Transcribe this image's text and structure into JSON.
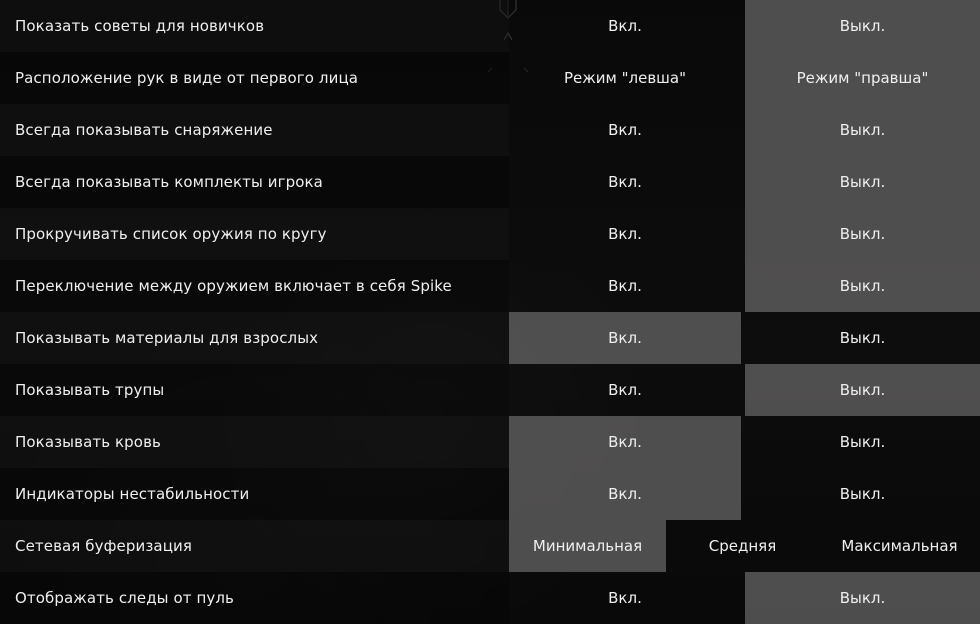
{
  "settings": [
    {
      "label": "Показать советы для новичков",
      "options": [
        "Вкл.",
        "Выкл."
      ],
      "selected": 1
    },
    {
      "label": "Расположение рук в виде от первого лица",
      "options": [
        "Режим \"левша\"",
        "Режим \"правша\""
      ],
      "selected": 1
    },
    {
      "label": "Всегда показывать снаряжение",
      "options": [
        "Вкл.",
        "Выкл."
      ],
      "selected": 1
    },
    {
      "label": "Всегда показывать комплекты игрока",
      "options": [
        "Вкл.",
        "Выкл."
      ],
      "selected": 1
    },
    {
      "label": "Прокручивать список оружия по кругу",
      "options": [
        "Вкл.",
        "Выкл."
      ],
      "selected": 1
    },
    {
      "label": "Переключение между оружием включает в себя Spike",
      "options": [
        "Вкл.",
        "Выкл."
      ],
      "selected": 1
    },
    {
      "label": "Показывать материалы для взрослых",
      "options": [
        "Вкл.",
        "Выкл."
      ],
      "selected": 0
    },
    {
      "label": "Показывать трупы",
      "options": [
        "Вкл.",
        "Выкл."
      ],
      "selected": 1
    },
    {
      "label": "Показывать кровь",
      "options": [
        "Вкл.",
        "Выкл."
      ],
      "selected": 0
    },
    {
      "label": "Индикаторы нестабильности",
      "options": [
        "Вкл.",
        "Выкл."
      ],
      "selected": 0
    },
    {
      "label": "Сетевая буферизация",
      "options": [
        "Минимальная",
        "Средняя",
        "Максимальная"
      ],
      "selected": 0
    },
    {
      "label": "Отображать следы от пуль",
      "options": [
        "Вкл.",
        "Выкл."
      ],
      "selected": 1
    }
  ]
}
